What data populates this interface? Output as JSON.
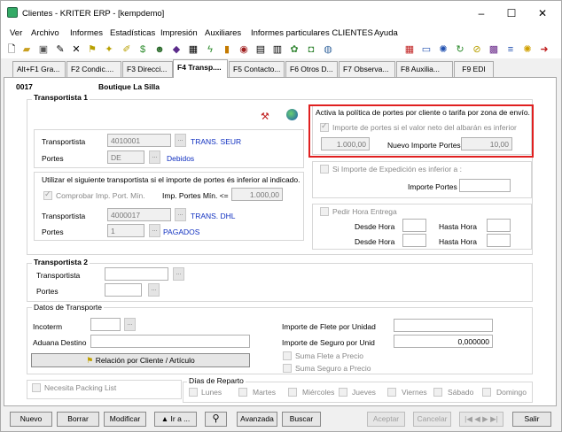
{
  "window": {
    "title": "Clientes - KRITER ERP - [kempdemo]",
    "controls": {
      "minimize": "–",
      "maximize": "☐",
      "close": "✕"
    }
  },
  "menu": [
    "Ver",
    "Archivo",
    "Informes",
    "Estadísticas",
    "Impresión",
    "Auxiliares",
    "Informes particulares CLIENTES",
    "Ayuda"
  ],
  "tabs": [
    "Alt+F1 Gra...",
    "F2 Condic....",
    "F3 Direcci...",
    "F4 Transp....",
    "F5 Contacto...",
    "F6 Otros D...",
    "F7 Observa...",
    "F8 Auxilia...",
    "F9 EDI"
  ],
  "header": {
    "code": "0017",
    "name": "Boutique La Silla"
  },
  "transportista1": {
    "title": "Transportista 1",
    "transportista_label": "Transportista",
    "transportista_code": "4010001",
    "transportista_name": "TRANS. SEUR",
    "portes_label": "Portes",
    "portes_code": "DE",
    "portes_name": "Debidos",
    "utilizar_text": "Utilizar el siguiente transportista si el importe de portes és inferior al indicado.",
    "comprobar_label": "Comprobar Imp. Port. Mín.",
    "imp_portes_min_label": "Imp. Portes Mín. <=",
    "imp_portes_min_value": "1.000,00",
    "transportista2_label": "Transportista",
    "transportista2_code": "4000017",
    "transportista2_name": "TRANS. DHL",
    "portes2_label": "Portes",
    "portes2_code": "1",
    "portes2_name": "PAGADOS"
  },
  "politica": {
    "title": "Activa la política de portes por cliente o tarifa por zona de envío.",
    "importe_check_label": "Importe de portes si el valor neto del albarán es inferior",
    "valor_neto": "1.000,00",
    "nuevo_importe_label": "Nuevo Importe Portes",
    "nuevo_importe_value": "10,00"
  },
  "expedicion": {
    "check_label": "Si Importe de Expedición es inferior a :",
    "importe_portes_label": "Importe Portes :",
    "importe_portes_value": ""
  },
  "hora_entrega": {
    "check_label": "Pedir Hora Entrega",
    "desde_label": "Desde Hora",
    "hasta_label": "Hasta Hora"
  },
  "transportista2": {
    "title": "Transportista 2",
    "transportista_label": "Transportista",
    "portes_label": "Portes"
  },
  "datos_transporte": {
    "title": "Datos de Transporte",
    "incoterm_label": "Incoterm",
    "aduana_label": "Aduana Destino",
    "relacion_button": "Relación por Cliente / Artículo",
    "flete_label": "Importe de Flete por Unidad",
    "flete_value": "",
    "seguro_label": "Importe de Seguro por Unid",
    "seguro_value": "0,000000",
    "suma_flete_label": "Suma Flete a Precio",
    "suma_seguro_label": "Suma Seguro a Precio"
  },
  "packing": {
    "label": "Necesita Packing List"
  },
  "dias_reparto": {
    "title": "Días de Reparto",
    "days": [
      "Lunes",
      "Martes",
      "Miércoles",
      "Jueves",
      "Viernes",
      "Sábado",
      "Domingo"
    ]
  },
  "bottom_buttons": {
    "nuevo": "Nuevo",
    "borrar": "Borrar",
    "modificar": "Modificar",
    "ira": "▲ Ir a ...",
    "avanzada": "Avanzada",
    "buscar": "Buscar",
    "aceptar": "Aceptar",
    "cancelar": "Cancelar",
    "nav": "|◀ ◀ ▶ ▶|",
    "salir": "Salir"
  },
  "colors": {
    "highlight": "#e02020",
    "link_blue": "#1030c0"
  }
}
